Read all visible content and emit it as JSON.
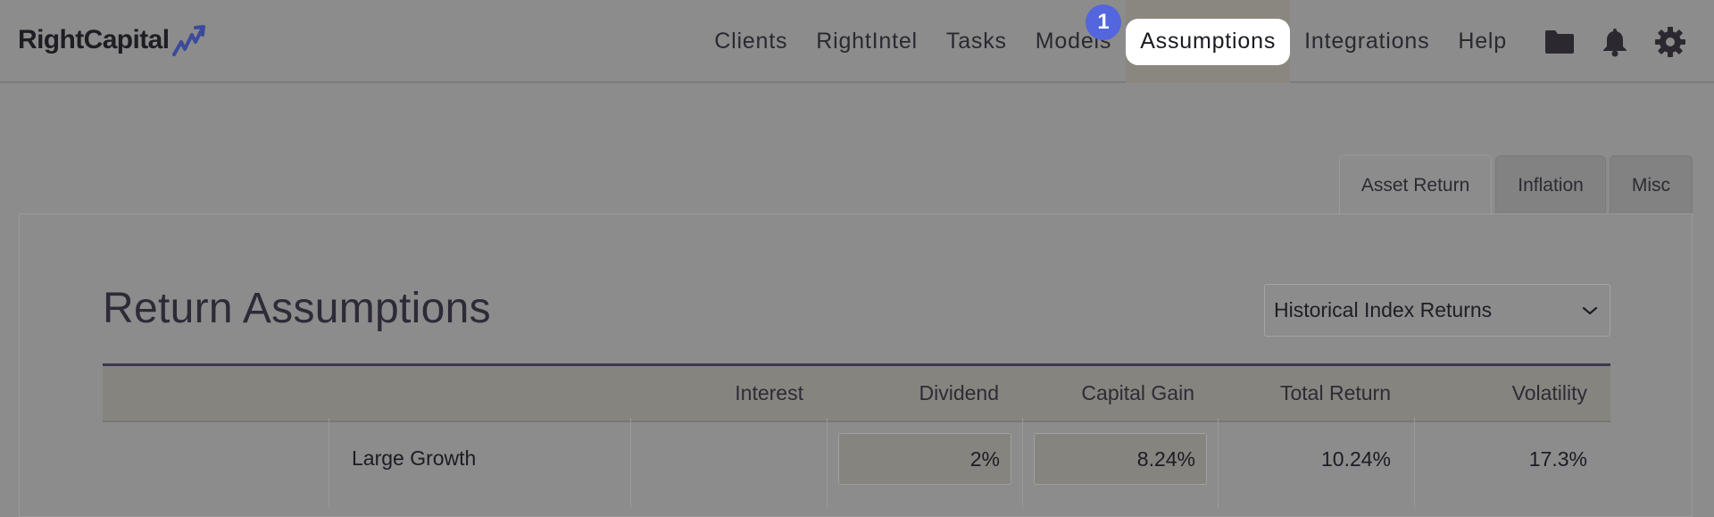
{
  "brand": {
    "name": "RightCapital"
  },
  "nav": {
    "items": [
      "Clients",
      "RightIntel",
      "Tasks",
      "Models",
      "Assumptions",
      "Integrations",
      "Help"
    ],
    "active": "Assumptions",
    "badge": "1",
    "icons": [
      "folder-icon",
      "bell-icon",
      "gear-icon"
    ]
  },
  "tabs": {
    "items": [
      "Asset Return",
      "Inflation",
      "Misc"
    ],
    "active": "Asset Return"
  },
  "page": {
    "title": "Return Assumptions",
    "select_value": "Historical Index Returns"
  },
  "table": {
    "headers": [
      "Interest",
      "Dividend",
      "Capital Gain",
      "Total Return",
      "Volatility"
    ],
    "rows": [
      {
        "label": "Large Growth",
        "interest": "",
        "dividend": "2%",
        "capital_gain": "8.24%",
        "total_return": "10.24%",
        "volatility": "17.3%"
      }
    ]
  },
  "colors": {
    "accent": "#5366dd",
    "brand_mark": "#3b4a9c"
  }
}
